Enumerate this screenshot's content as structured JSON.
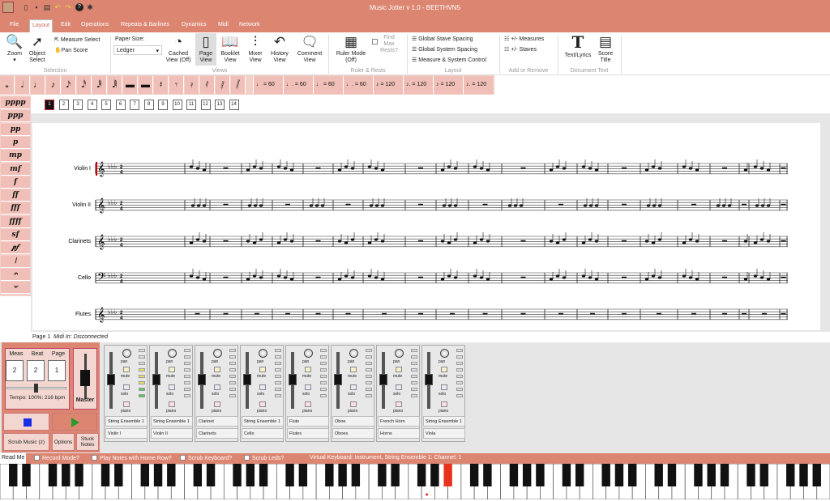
{
  "app": {
    "title": "Music Jotter v 1.0 - BEETHVN5"
  },
  "tabs": [
    {
      "label": "File"
    },
    {
      "label": "Layout"
    },
    {
      "label": "Edit"
    },
    {
      "label": "Operations"
    },
    {
      "label": "Repeats & Barlines"
    },
    {
      "label": "Dynamics"
    },
    {
      "label": "Midi"
    },
    {
      "label": "Network"
    }
  ],
  "ribbon": {
    "zoom": "Zoom",
    "object_select": "Object Select",
    "measure_select": "Measure Select",
    "pan_score": "Pan Score",
    "selection_group": "Selection",
    "paper_size_label": "Paper Size:",
    "paper_size_value": "Ledger",
    "cached_view": "Cached View (Off)",
    "page_view": "Page View",
    "booklet_view": "Booklet View",
    "mixer_view": "Mixer View",
    "history_view": "History View",
    "comment_view": "Comment View",
    "views_group": "Views",
    "ruler_mode": "Ruler Mode (Off)",
    "find_max_rests": "Find Max Rests?",
    "ruler_group": "Ruler & Rests",
    "global_stave_spacing": "Global Stave Spacing",
    "global_system_spacing": "Global System Spacing",
    "measure_system_control": "Measure & System Control",
    "layout_group": "Layout",
    "measures_pm": "+/- Measures",
    "staves_pm": "+/- Staves",
    "add_remove_group": "Add or Remove",
    "text_lyrics": "Text/Lyrics",
    "score_title": "Score Title",
    "document_text_group": "Document Text"
  },
  "note_palette": [
    "𝅝",
    "𝅗𝅥",
    "♩",
    "♪",
    "𝅘𝅥𝅯",
    "𝅘𝅥𝅰",
    "𝅘𝅥𝅱",
    "𝅘𝅥𝅲",
    "▬",
    "▬",
    "𝄽",
    "𝄾",
    "𝄿",
    "𝅀",
    "𝅁",
    "𝅂"
  ],
  "tempo_buttons": [
    "♩ = 60",
    "♩. = 60",
    "♩ = 60",
    "♩. = 60",
    "♪ = 120",
    "♪. = 120",
    "♪ = 120",
    "♪. = 120"
  ],
  "dynamics": [
    "pppp",
    "ppp",
    "pp",
    "p",
    "mp",
    "mf",
    "f",
    "ff",
    "fff",
    "ffff",
    "sf",
    "𝆏𝆑",
    "𝆃",
    "𝄐",
    "𝄑"
  ],
  "pages": [
    "1",
    "2",
    "3",
    "4",
    "5",
    "6",
    "7",
    "8",
    "9",
    "10",
    "11",
    "12",
    "13",
    "14"
  ],
  "score": {
    "staves": [
      "Violin I",
      "Violin II",
      "Clarinets",
      "Cello",
      "Flutes"
    ],
    "time_signature": "2/4"
  },
  "status": {
    "page": "Page 1",
    "midi": "Midi In: Disconnected"
  },
  "transport": {
    "meas_label": "Meas",
    "beat_label": "Beat",
    "page_label": "Page",
    "meas": "2",
    "beat": "2",
    "page": "1",
    "tempo": "Tempo: 100%: 216 bpm",
    "master": "Master",
    "scrub": "Scrub Music (z)",
    "options": "Options",
    "stuck_notes": "Stuck Notes",
    "stop_color": "#1a2ee6",
    "play_color": "#2a9a2a"
  },
  "mixer": {
    "pan": "pan",
    "mute": "mute",
    "solo": "solo",
    "piano": "piano",
    "channels": [
      {
        "instrument": "String Ensemble 1",
        "part": "Violin I"
      },
      {
        "instrument": "String Ensemble 1",
        "part": "Violin II"
      },
      {
        "instrument": "Clarinet",
        "part": "Clarinets"
      },
      {
        "instrument": "String Ensemble 1",
        "part": "Cello"
      },
      {
        "instrument": "Flute",
        "part": "Flutes"
      },
      {
        "instrument": "Oboe",
        "part": "Oboes"
      },
      {
        "instrument": "French Horn",
        "part": "Horns"
      },
      {
        "instrument": "String Ensemble 1",
        "part": "Viola"
      }
    ]
  },
  "bottom": {
    "read_me": "Read Me",
    "record_mode": "Record Mode?",
    "play_home": "Play Notes with Home Row?",
    "scrub_keyboard": "Scrub Keyboard?",
    "scrub_leds": "Scrub Leds?",
    "virtual_keyboard": "Virtual Keyboard: Instrument, String Ensemble 1: Channel: 1"
  },
  "colors": {
    "accent": "#dc8672",
    "pressed_key": "#e8321e"
  }
}
